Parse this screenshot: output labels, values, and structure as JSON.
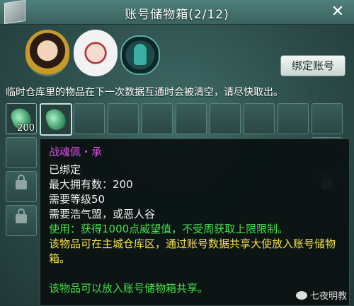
{
  "window": {
    "title": "账号储物箱(2/12)",
    "close_icon": "close-icon"
  },
  "characters": [
    {
      "name": "portrait-1",
      "icon": "female-portrait"
    },
    {
      "name": "portrait-2",
      "icon": "hooded-portrait"
    },
    {
      "name": "portrait-3",
      "icon": "silhouette-portrait"
    }
  ],
  "bind_button": "绑定账号",
  "notice": "临时仓库里的物品在下一次数据互通时会被清空，请尽快取出。",
  "slots": {
    "first_count": "200",
    "lock_icon": "lock-icon"
  },
  "tooltip": {
    "name": "战魂佩・承",
    "bound": "已绑定",
    "max_owned": "最大拥有数：200",
    "level": "需要等级50",
    "faction": "需要浩气盟，或恶人谷",
    "use": "使用：获得1000点威望值，不受周获取上限限制。",
    "desc": "该物品可在主城仓库区，通过账号数据共享大使放入账号储物箱。",
    "share": "该物品可以放入账号储物箱共享。"
  },
  "watermark": "七夜明教",
  "colors": {
    "name": "#d94fe0",
    "green": "#43e04a",
    "yellow": "#f4e24a"
  }
}
